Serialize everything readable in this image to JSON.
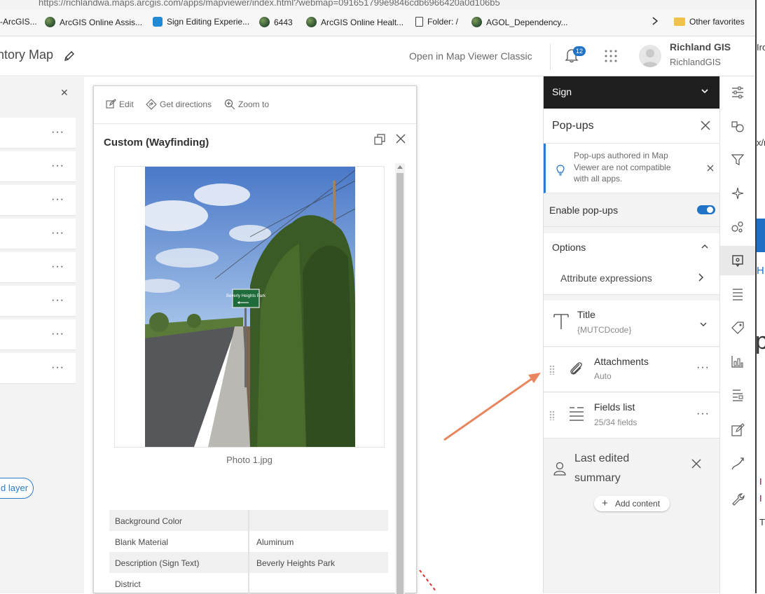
{
  "browser": {
    "url": "https://richlandwa.maps.arcgis.com/apps/mapviewer/index.html?webmap=091651799e9846cdb6966420a0d106b5",
    "bookmarks": [
      {
        "label": "-ArcGIS...",
        "icon": "none"
      },
      {
        "label": "ArcGIS Online Assis...",
        "icon": "globe-icon"
      },
      {
        "label": "Sign Editing Experie...",
        "icon": "app-icon"
      },
      {
        "label": "6443",
        "icon": "globe-icon"
      },
      {
        "label": "ArcGIS Online Healt...",
        "icon": "globe-icon"
      },
      {
        "label": "Folder: /",
        "icon": "document-icon"
      },
      {
        "label": "AGOL_Dependency...",
        "icon": "globe-icon"
      }
    ],
    "other_favorites": "Other favorites",
    "sync_status": "Not syncing"
  },
  "header": {
    "map_title": "ntory Map",
    "open_classic": "Open in Map Viewer Classic",
    "notification_count": "12",
    "user_name": "Richland GIS",
    "user_handle": "RichlandGIS"
  },
  "layers_panel": {
    "row_menu": "···",
    "add_layer": "d layer"
  },
  "popup": {
    "actions": {
      "edit": "Edit",
      "directions": "Get directions",
      "zoom": "Zoom to"
    },
    "title": "Custom (Wayfinding)",
    "photo_caption": "Photo 1.jpg",
    "photo_sign_text": "Beverly Heights Park",
    "fields": [
      {
        "key": "Background Color",
        "value": ""
      },
      {
        "key": "Blank Material",
        "value": "Aluminum"
      },
      {
        "key": "Description (Sign Text)",
        "value": "Beverly Heights Park"
      },
      {
        "key": "District",
        "value": ""
      }
    ]
  },
  "config": {
    "layer_name": "Sign",
    "panel_title": "Pop-ups",
    "notice": "Pop-ups authored in Map Viewer are not compatible with all apps.",
    "enable_label": "Enable pop-ups",
    "enable_on": true,
    "options_title": "Options",
    "attribute_expressions": "Attribute expressions",
    "elements": [
      {
        "title": "Title",
        "subtitle": "{MUTCDcode}",
        "icon": "text-icon"
      },
      {
        "title": "Attachments",
        "subtitle": "Auto",
        "icon": "paperclip-icon"
      },
      {
        "title": "Fields list",
        "subtitle": "25/34 fields",
        "icon": "list-icon"
      }
    ],
    "last_edited": "Last edited summary",
    "add_content": "Add content",
    "menu": "···"
  },
  "colors": {
    "accent": "#2173c5",
    "dark_header": "#1f1f1f",
    "arrow": "#e8845e"
  },
  "side_window_fragments": [
    "Iro",
    "x/r",
    "H",
    "p",
    "I",
    "I",
    "T"
  ]
}
